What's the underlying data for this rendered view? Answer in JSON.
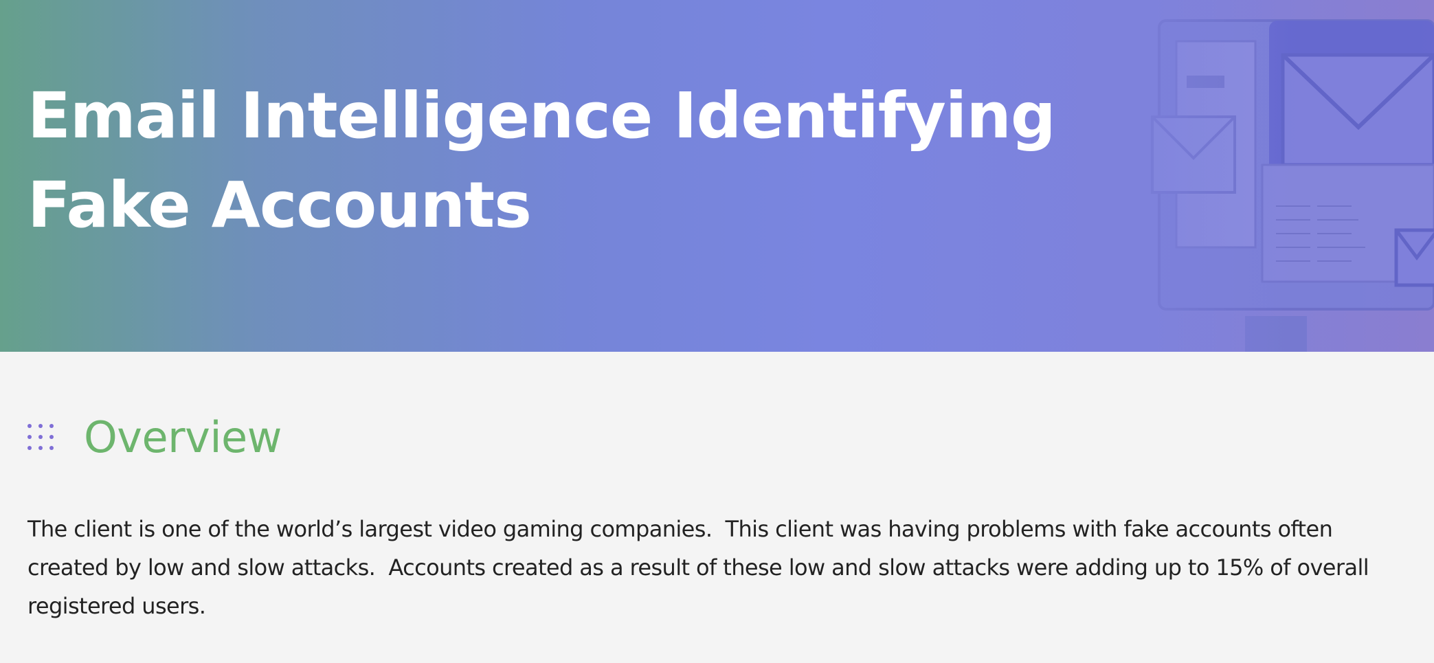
{
  "hero": {
    "title_line1": "Email Intelligence Identifying",
    "title_line2": "Fake Accounts",
    "background_art_icon": "email-envelopes-illustration",
    "gradient_colors": [
      "#66a08c",
      "#7585d8",
      "#8a7ed0"
    ]
  },
  "overview": {
    "icon": "dot-grid-icon",
    "heading": "Overview",
    "heading_color": "#6db56d",
    "icon_color": "#7f6ed6",
    "body": "The client is one of the world’s largest video gaming companies.  This client was having problems with fake accounts often created by low and slow attacks.  Accounts created as a result of these low and slow attacks were adding up to 15% of overall registered users."
  }
}
